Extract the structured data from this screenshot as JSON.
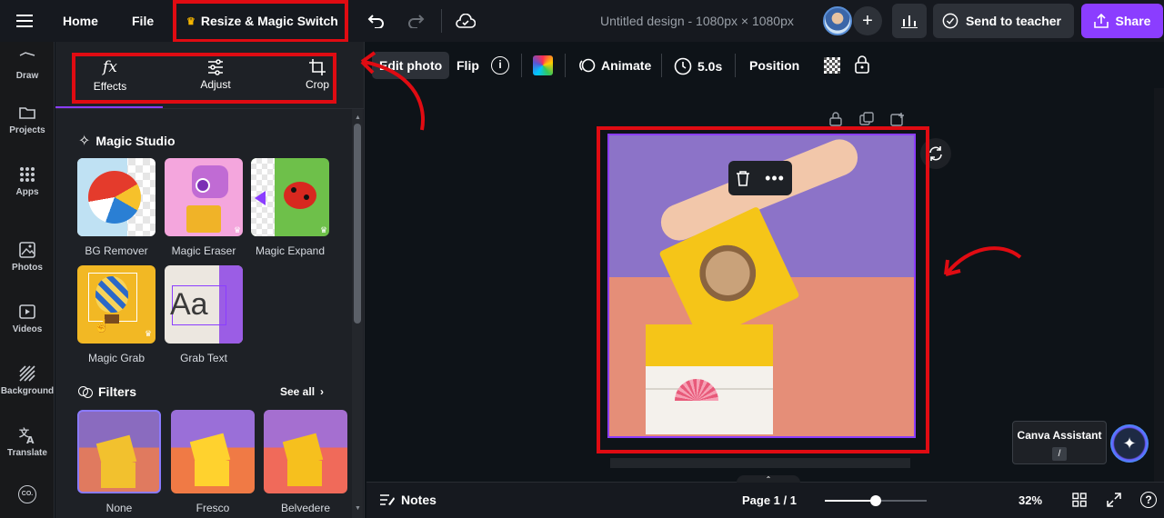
{
  "topbar": {
    "home": "Home",
    "file": "File",
    "resize": "Resize & Magic Switch",
    "title": "Untitled design - 1080px × 1080px",
    "send": "Send to teacher",
    "share": "Share"
  },
  "sidebar": {
    "items": [
      {
        "label": "Draw",
        "icon": "draw-icon"
      },
      {
        "label": "Projects",
        "icon": "folder-icon"
      },
      {
        "label": "Apps",
        "icon": "grid-icon"
      },
      {
        "label": "Photos",
        "icon": "image-icon"
      },
      {
        "label": "Videos",
        "icon": "video-icon"
      },
      {
        "label": "Background",
        "icon": "hatch-icon"
      },
      {
        "label": "Translate",
        "icon": "translate-icon"
      }
    ]
  },
  "panel": {
    "tabs": [
      {
        "label": "Effects",
        "icon": "fx-icon"
      },
      {
        "label": "Adjust",
        "icon": "sliders-icon"
      },
      {
        "label": "Crop",
        "icon": "crop-icon"
      }
    ],
    "magic_title": "Magic Studio",
    "magic_items": [
      "BG Remover",
      "Magic Eraser",
      "Magic Expand",
      "Magic Grab",
      "Grab Text"
    ],
    "filters_title": "Filters",
    "see_all": "See all",
    "filters": [
      "None",
      "Fresco",
      "Belvedere"
    ]
  },
  "toolbar": {
    "edit_photo": "Edit photo",
    "flip": "Flip",
    "animate": "Animate",
    "duration": "5.0s",
    "position": "Position"
  },
  "bottom": {
    "notes": "Notes",
    "page": "Page 1 / 1",
    "zoom": "32%",
    "zoom_fraction": 0.5
  },
  "assistant": {
    "label": "Canva Assistant",
    "shortcut": "/"
  },
  "colors": {
    "accent": "#8b3dff",
    "highlight": "#e00b12"
  }
}
